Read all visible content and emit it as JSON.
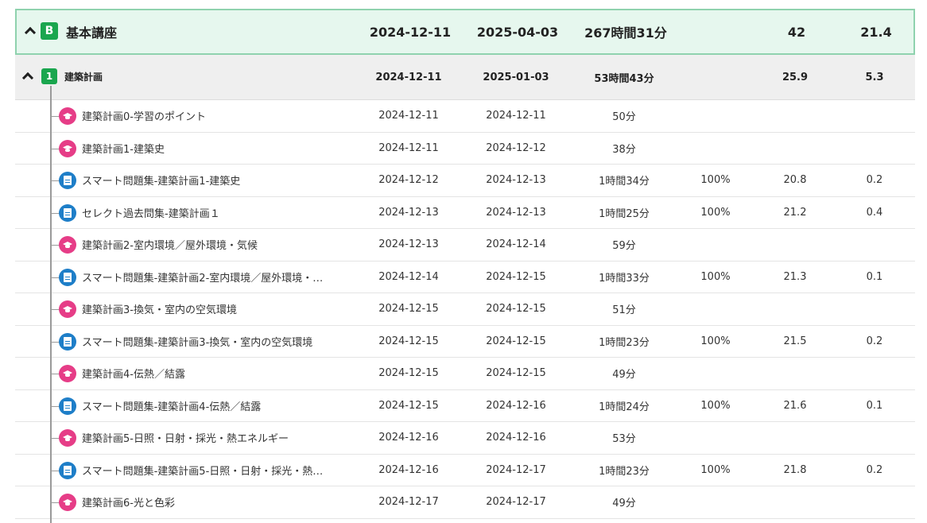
{
  "course": {
    "badge": "B",
    "title": "基本講座",
    "start": "2024-12-11",
    "end": "2025-04-03",
    "time": "267時間31分",
    "rate": "",
    "score": "42",
    "extra": "21.4"
  },
  "section": {
    "badge": "1",
    "title": "建築計画",
    "start": "2024-12-11",
    "end": "2025-01-03",
    "time": "53時間43分",
    "rate": "",
    "score": "25.9",
    "extra": "5.3"
  },
  "items": [
    {
      "icon": "lecture",
      "name": "建築計画0-学習のポイント",
      "start": "2024-12-11",
      "end": "2024-12-11",
      "time": "50分",
      "rate": "",
      "score": "",
      "extra": ""
    },
    {
      "icon": "lecture",
      "name": "建築計画1-建築史",
      "start": "2024-12-11",
      "end": "2024-12-12",
      "time": "38分",
      "rate": "",
      "score": "",
      "extra": ""
    },
    {
      "icon": "quiz",
      "name": "スマート問題集-建築計画1-建築史",
      "start": "2024-12-12",
      "end": "2024-12-13",
      "time": "1時間34分",
      "rate": "100%",
      "score": "20.8",
      "extra": "0.2"
    },
    {
      "icon": "quiz",
      "name": "セレクト過去問集-建築計画１",
      "start": "2024-12-13",
      "end": "2024-12-13",
      "time": "1時間25分",
      "rate": "100%",
      "score": "21.2",
      "extra": "0.4"
    },
    {
      "icon": "lecture",
      "name": "建築計画2-室内環境／屋外環境・気候",
      "start": "2024-12-13",
      "end": "2024-12-14",
      "time": "59分",
      "rate": "",
      "score": "",
      "extra": ""
    },
    {
      "icon": "quiz",
      "name": "スマート問題集-建築計画2-室内環境／屋外環境・…",
      "start": "2024-12-14",
      "end": "2024-12-15",
      "time": "1時間33分",
      "rate": "100%",
      "score": "21.3",
      "extra": "0.1"
    },
    {
      "icon": "lecture",
      "name": "建築計画3-換気・室内の空気環境",
      "start": "2024-12-15",
      "end": "2024-12-15",
      "time": "51分",
      "rate": "",
      "score": "",
      "extra": ""
    },
    {
      "icon": "quiz",
      "name": "スマート問題集-建築計画3-換気・室内の空気環境",
      "start": "2024-12-15",
      "end": "2024-12-15",
      "time": "1時間23分",
      "rate": "100%",
      "score": "21.5",
      "extra": "0.2"
    },
    {
      "icon": "lecture",
      "name": "建築計画4-伝熱／結露",
      "start": "2024-12-15",
      "end": "2024-12-15",
      "time": "49分",
      "rate": "",
      "score": "",
      "extra": ""
    },
    {
      "icon": "quiz",
      "name": "スマート問題集-建築計画4-伝熱／結露",
      "start": "2024-12-15",
      "end": "2024-12-16",
      "time": "1時間24分",
      "rate": "100%",
      "score": "21.6",
      "extra": "0.1"
    },
    {
      "icon": "lecture",
      "name": "建築計画5-日照・日射・採光・熱エネルギー",
      "start": "2024-12-16",
      "end": "2024-12-16",
      "time": "53分",
      "rate": "",
      "score": "",
      "extra": ""
    },
    {
      "icon": "quiz",
      "name": "スマート問題集-建築計画5-日照・日射・採光・熱…",
      "start": "2024-12-16",
      "end": "2024-12-17",
      "time": "1時間23分",
      "rate": "100%",
      "score": "21.8",
      "extra": "0.2"
    },
    {
      "icon": "lecture",
      "name": "建築計画6-光と色彩",
      "start": "2024-12-17",
      "end": "2024-12-17",
      "time": "49分",
      "rate": "",
      "score": "",
      "extra": ""
    }
  ]
}
